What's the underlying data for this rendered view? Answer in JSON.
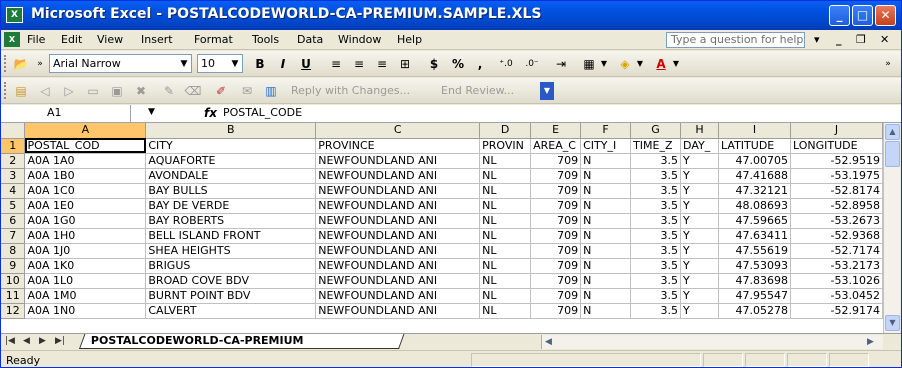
{
  "title": "Microsoft Excel - POSTALCODEWORLD-CA-PREMIUM.SAMPLE.XLS",
  "title_icon": "excel-icon",
  "menu": [
    "File",
    "Edit",
    "View",
    "Insert",
    "Format",
    "Tools",
    "Data",
    "Window",
    "Help"
  ],
  "help_placeholder": "Type a question for help",
  "format_toolbar": {
    "font": "Arial Narrow",
    "size": "10",
    "bold": "B",
    "italic": "I",
    "underline": "U",
    "currency": "$",
    "percent": "%",
    "comma": ","
  },
  "review_toolbar": {
    "reply": "Reply with Changes...",
    "end": "End Review..."
  },
  "formula_bar": {
    "cell": "A1",
    "fx": "fx",
    "content": "POSTAL_CODE"
  },
  "columns": [
    "A",
    "B",
    "C",
    "D",
    "E",
    "F",
    "G",
    "H",
    "I",
    "J"
  ],
  "rows": [
    [
      "POSTAL_COD",
      "CITY",
      "PROVINCE",
      "PROVIN",
      "AREA_C",
      "CITY_I",
      "TIME_Z",
      "DAY_",
      "LATITUDE",
      "LONGITUDE"
    ],
    [
      "A0A 1A0",
      "AQUAFORTE",
      "NEWFOUNDLAND ANI",
      "NL",
      "709",
      "N",
      "3.5",
      "Y",
      "47.00705",
      "-52.9519"
    ],
    [
      "A0A 1B0",
      "AVONDALE",
      "NEWFOUNDLAND ANI",
      "NL",
      "709",
      "N",
      "3.5",
      "Y",
      "47.41688",
      "-53.1975"
    ],
    [
      "A0A 1C0",
      "BAY BULLS",
      "NEWFOUNDLAND ANI",
      "NL",
      "709",
      "N",
      "3.5",
      "Y",
      "47.32121",
      "-52.8174"
    ],
    [
      "A0A 1E0",
      "BAY DE VERDE",
      "NEWFOUNDLAND ANI",
      "NL",
      "709",
      "N",
      "3.5",
      "Y",
      "48.08693",
      "-52.8958"
    ],
    [
      "A0A 1G0",
      "BAY ROBERTS",
      "NEWFOUNDLAND ANI",
      "NL",
      "709",
      "N",
      "3.5",
      "Y",
      "47.59665",
      "-53.2673"
    ],
    [
      "A0A 1H0",
      "BELL ISLAND FRONT",
      "NEWFOUNDLAND ANI",
      "NL",
      "709",
      "N",
      "3.5",
      "Y",
      "47.63411",
      "-52.9368"
    ],
    [
      "A0A 1J0",
      "SHEA HEIGHTS",
      "NEWFOUNDLAND ANI",
      "NL",
      "709",
      "N",
      "3.5",
      "Y",
      "47.55619",
      "-52.7174"
    ],
    [
      "A0A 1K0",
      "BRIGUS",
      "NEWFOUNDLAND ANI",
      "NL",
      "709",
      "N",
      "3.5",
      "Y",
      "47.53093",
      "-53.2173"
    ],
    [
      "A0A 1L0",
      "BROAD COVE BDV",
      "NEWFOUNDLAND ANI",
      "NL",
      "709",
      "N",
      "3.5",
      "Y",
      "47.83698",
      "-53.1026"
    ],
    [
      "A0A 1M0",
      "BURNT POINT BDV",
      "NEWFOUNDLAND ANI",
      "NL",
      "709",
      "N",
      "3.5",
      "Y",
      "47.95547",
      "-53.0452"
    ],
    [
      "A0A 1N0",
      "CALVERT",
      "NEWFOUNDLAND ANI",
      "NL",
      "709",
      "N",
      "3.5",
      "Y",
      "47.05278",
      "-52.9174"
    ]
  ],
  "sheet_tab": "POSTALCODEWORLD-CA-PREMIUM",
  "status": "Ready"
}
